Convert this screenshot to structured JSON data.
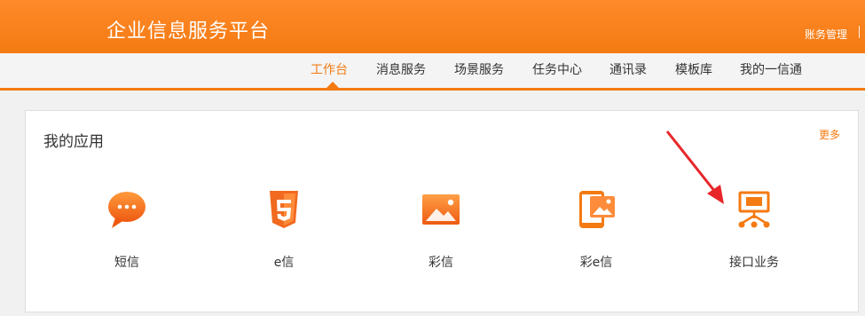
{
  "header": {
    "title": "企业信息服务平台",
    "account_label": "账务管理"
  },
  "nav": {
    "items": [
      "工作台",
      "消息服务",
      "场景服务",
      "任务中心",
      "通讯录",
      "模板库",
      "我的一信通"
    ],
    "active_index": 0
  },
  "panel": {
    "title": "我的应用",
    "more_label": "更多"
  },
  "apps": [
    {
      "label": "短信",
      "icon": "chat-bubble-icon"
    },
    {
      "label": "e信",
      "icon": "html5-icon"
    },
    {
      "label": "彩信",
      "icon": "image-icon"
    },
    {
      "label": "彩e信",
      "icon": "phone-image-icon"
    },
    {
      "label": "接口业务",
      "icon": "network-icon"
    }
  ],
  "colors": {
    "accent": "#f47a12",
    "annotation_arrow": "#e8262a"
  }
}
